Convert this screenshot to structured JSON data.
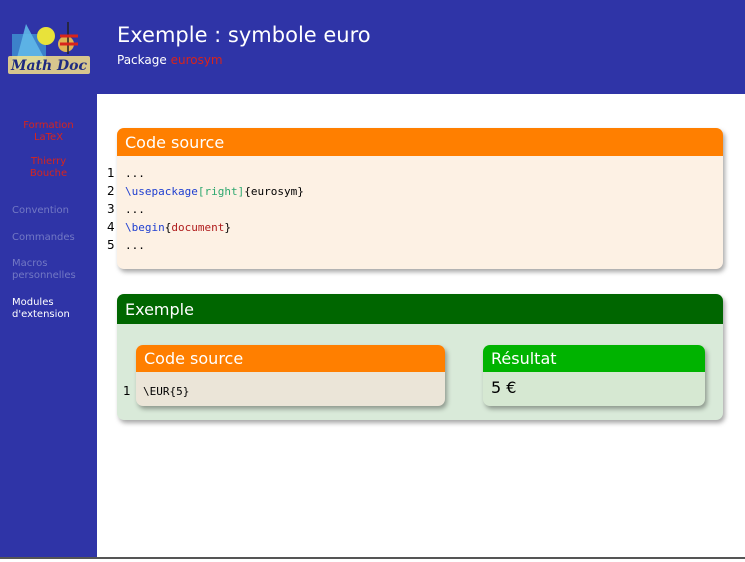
{
  "header": {
    "title": "Exemple : symbole euro",
    "subtitle_prefix": "Package",
    "subtitle_package": "eurosym"
  },
  "sidebar": {
    "logo_text": "Math Doc",
    "formation_line1": "Formation",
    "formation_line2": "LaTeX",
    "author_line1": "Thierry",
    "author_line2": "Bouche",
    "items": [
      {
        "label": "Convention"
      },
      {
        "label": "Commandes"
      },
      {
        "label": "Macros",
        "label2": "personnelles"
      },
      {
        "label": "Modules",
        "label2": "d'extension"
      }
    ]
  },
  "code_block": {
    "title": "Code source",
    "lines": [
      {
        "num": "1",
        "plain": "..."
      },
      {
        "num": "2",
        "cmd": "\\usepackage",
        "opt": "[right]",
        "rest": "{eurosym}"
      },
      {
        "num": "3",
        "plain": "..."
      },
      {
        "num": "4",
        "cmd": "\\begin",
        "open": "{",
        "arg": "document",
        "close": "}"
      },
      {
        "num": "5",
        "plain": "..."
      }
    ]
  },
  "example_block": {
    "title": "Exemple",
    "source": {
      "title": "Code source",
      "line_num": "1",
      "code": "\\EUR{5}"
    },
    "result": {
      "title": "Résultat",
      "value": "5 €"
    }
  },
  "colors": {
    "theme_blue": "#2f34a7",
    "orange": "#ff7f00",
    "dark_green": "#006600",
    "bright_green": "#00b300",
    "red": "#d8241c",
    "code_bg": "#fdf1e4",
    "example_bg": "#d9ead9"
  }
}
